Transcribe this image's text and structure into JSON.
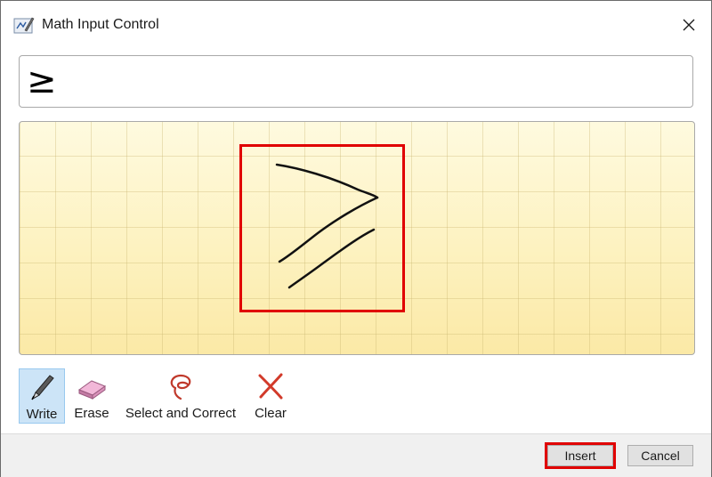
{
  "window": {
    "title": "Math Input Control",
    "close_glyph": "✕"
  },
  "preview": {
    "symbol": "≥"
  },
  "toolbar": {
    "tools": [
      {
        "label": "Write",
        "icon": "pen-icon",
        "active": true
      },
      {
        "label": "Erase",
        "icon": "eraser-icon",
        "active": false
      },
      {
        "label": "Select and Correct",
        "icon": "lasso-icon",
        "active": false
      },
      {
        "label": "Clear",
        "icon": "clear-x-icon",
        "active": false
      }
    ]
  },
  "footer": {
    "insert_label": "Insert",
    "cancel_label": "Cancel"
  },
  "colors": {
    "highlight": "#e00000",
    "canvas_bg": "#fdf3c4",
    "active_tool": "#cce4f7"
  }
}
